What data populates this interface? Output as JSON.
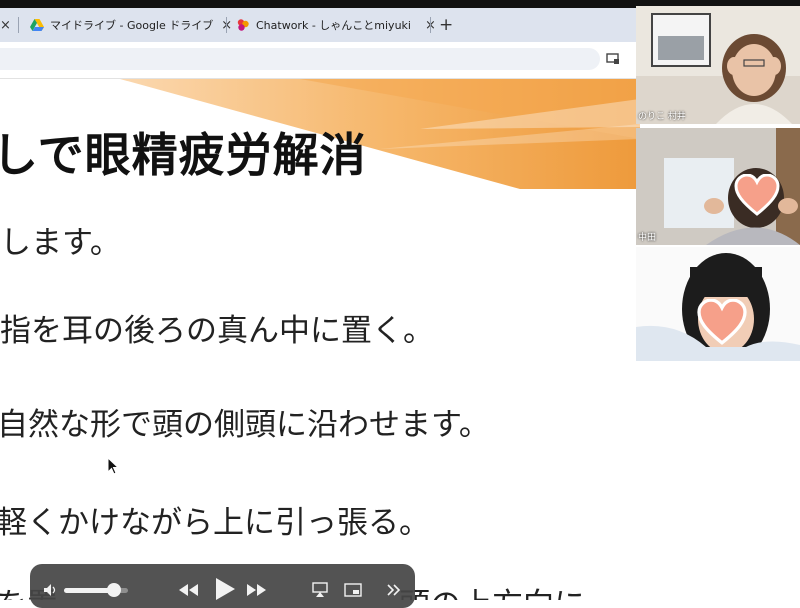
{
  "browser": {
    "tabs": [
      {
        "label": "",
        "close": "×"
      },
      {
        "label": "マイドライブ - Google ドライブ",
        "close": "×"
      },
      {
        "label": "Chatwork - しゃんことmiyuki",
        "close": "×"
      }
    ],
    "new_tab": "+"
  },
  "slide": {
    "title": "しで眼精疲労解消",
    "lines": [
      "します。",
      "指を耳の後ろの真ん中に置く。",
      "自然な形で頭の側頭に沿わせます。",
      "軽くかけながら上に引っ張る。",
      "を置　　　　　　　　　　　頭の上方向に"
    ]
  },
  "participants": [
    {
      "name": "のりこ 村井"
    },
    {
      "name": "中田"
    },
    {
      "name": ""
    }
  ],
  "player": {
    "volume_fraction": 0.78,
    "icons": [
      "volume-icon",
      "rewind-icon",
      "play-icon",
      "fast-forward-icon",
      "airplay-icon",
      "pip-icon",
      "more-icon"
    ]
  },
  "colors": {
    "tab_bar": "#dde3ee",
    "slide_accent": "#f0a24a",
    "player_bg": "#464646"
  }
}
